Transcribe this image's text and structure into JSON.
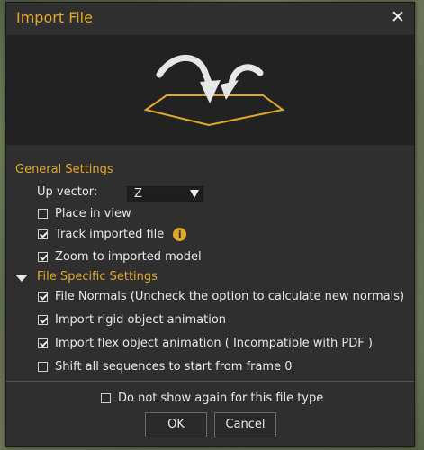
{
  "dialog": {
    "title": "Import File",
    "close_glyph": "✕"
  },
  "general": {
    "heading": "General Settings",
    "up_vector_label": "Up vector:",
    "up_vector_value": "Z",
    "place_in_view": {
      "label": "Place in view",
      "checked": false
    },
    "track_imported": {
      "label": "Track imported file",
      "checked": true
    },
    "zoom_to_model": {
      "label": "Zoom to imported model",
      "checked": true
    }
  },
  "file_specific": {
    "heading": "File Specific Settings",
    "file_normals": {
      "label": "File Normals (Uncheck the option to calculate new normals)",
      "checked": true
    },
    "rigid_anim": {
      "label": "Import rigid object animation",
      "checked": true
    },
    "flex_anim": {
      "label": "Import flex object animation ( Incompatible with PDF )",
      "checked": true
    },
    "shift_sequences": {
      "label": "Shift all sequences to start from frame 0",
      "checked": false
    }
  },
  "footer": {
    "do_not_show": {
      "label": "Do not show again for this file type",
      "checked": false
    },
    "ok_label": "OK",
    "cancel_label": "Cancel"
  },
  "colors": {
    "accent": "#e0a92a",
    "dialog_bg": "#2f2f2f",
    "banner_bg": "#222222"
  },
  "icons": [
    "close-icon",
    "import-illustration",
    "info-icon",
    "dropdown-arrow-icon",
    "collapse-triangle-icon",
    "checkmark-icon"
  ]
}
